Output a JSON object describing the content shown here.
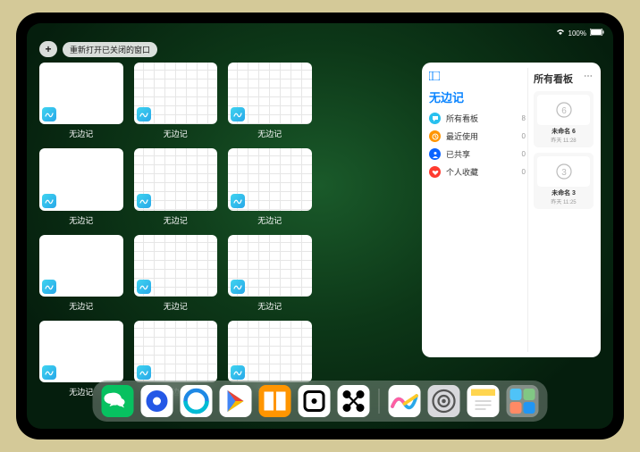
{
  "statusbar": {
    "time": "",
    "battery": "100%"
  },
  "pills": {
    "add": "+",
    "reopen": "重新打开已关闭的窗口"
  },
  "thumb_label": "无边记",
  "thumb_kinds": [
    "blank",
    "grid",
    "grid",
    "x",
    "blank",
    "grid",
    "grid",
    "x",
    "blank",
    "grid",
    "grid",
    "x",
    "blank",
    "grid",
    "grid",
    "x"
  ],
  "thumb_visible": [
    1,
    1,
    1,
    0,
    1,
    1,
    1,
    0,
    1,
    1,
    1,
    0,
    1,
    1,
    1,
    0
  ],
  "panel": {
    "title": "无边记",
    "items": [
      {
        "label": "所有看板",
        "count": "8",
        "color": "#28c0ef",
        "icon": "bubble"
      },
      {
        "label": "最近使用",
        "count": "0",
        "color": "#ff9500",
        "icon": "clock"
      },
      {
        "label": "已共享",
        "count": "0",
        "color": "#0a63ff",
        "icon": "person"
      },
      {
        "label": "个人收藏",
        "count": "0",
        "color": "#ff3b30",
        "icon": "heart"
      }
    ],
    "right_title": "所有看板",
    "boards": [
      {
        "name": "未命名 6",
        "time": "昨天 11:28",
        "digit": "6"
      },
      {
        "name": "未命名 3",
        "time": "昨天 11:25",
        "digit": "3"
      }
    ]
  },
  "dock": [
    {
      "name": "wechat",
      "bg": "#07c160"
    },
    {
      "name": "browser1",
      "bg": "#ffffff"
    },
    {
      "name": "browser2",
      "bg": "#ffffff"
    },
    {
      "name": "play",
      "bg": "#ffffff"
    },
    {
      "name": "books",
      "bg": "#ff9500"
    },
    {
      "name": "dice",
      "bg": "#ffffff"
    },
    {
      "name": "connect",
      "bg": "#ffffff"
    },
    {
      "name": "sep"
    },
    {
      "name": "freeform",
      "bg": "#ffffff"
    },
    {
      "name": "settings",
      "bg": "#d8d8dc"
    },
    {
      "name": "notes",
      "bg": "#ffffff"
    },
    {
      "name": "folder",
      "bg": ""
    }
  ]
}
